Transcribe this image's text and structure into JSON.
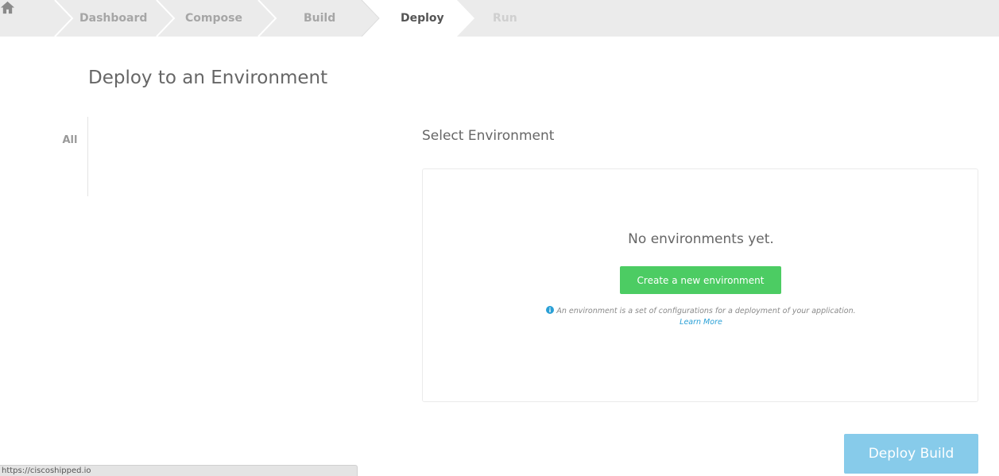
{
  "breadcrumb": {
    "home_icon": "home-icon",
    "items": [
      {
        "label": "Dashboard",
        "state": "done"
      },
      {
        "label": "Compose",
        "state": "done"
      },
      {
        "label": "Build",
        "state": "done"
      },
      {
        "label": "Deploy",
        "state": "active"
      },
      {
        "label": "Run",
        "state": "disabled"
      }
    ]
  },
  "page": {
    "title": "Deploy to an Environment"
  },
  "filters": {
    "all_label": "All"
  },
  "environments": {
    "section_title": "Select Environment",
    "empty_message": "No environments yet.",
    "create_button_label": "Create a new environment",
    "hint_icon": "info-icon",
    "hint_text": "An environment is a set of configurations for a deployment of your application.",
    "learn_more_label": "Learn More"
  },
  "actions": {
    "deploy_build_label": "Deploy Build"
  },
  "statusbar": {
    "url": "https://ciscoshipped.io"
  },
  "colors": {
    "accent_green": "#4ccc63",
    "deploy_blue": "#87cbea",
    "link_blue": "#2aa0d6",
    "breadcrumb_bg": "#ebebeb"
  }
}
